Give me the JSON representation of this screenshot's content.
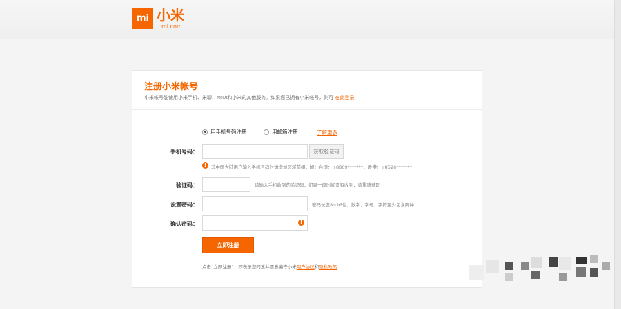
{
  "header": {
    "logo_mark": "mi",
    "logo_name": "小米",
    "logo_domain": "mi.com"
  },
  "card": {
    "title": "注册小米帐号",
    "subtitle_text": "小米帐号能使用小米手机、米聊、MIUI和小米的其他服务。如果您已拥有小米帐号，则可",
    "subtitle_link": "在此登录"
  },
  "register_options": {
    "phone_label": "用手机号码注册",
    "email_label": "用邮箱注册",
    "selected": "phone",
    "learn_more": "了解更多"
  },
  "form": {
    "phone_label": "手机号码：",
    "phone_value": "",
    "get_code_label": "获取验证码",
    "phone_hint": "非中国大陆用户输入手机号码时请增加区域前缀，如：台湾：+8869*******，香港：+8526*******",
    "code_label": "验证码：",
    "code_value": "",
    "code_hint": "请输入手机收到的验证码，如果一段时间没有收到，请重新获取",
    "password_label": "设置密码：",
    "password_value": "",
    "password_hint": "密码长度8~16位，数字、字母、字符至少包含两种",
    "confirm_label": "确认密码：",
    "confirm_value": "",
    "register_label": "立即注册"
  },
  "terms": {
    "prefix": "点击“立即注册”，即表示您同意并愿意遵守小米",
    "user_agreement": "用户协议",
    "and": "和",
    "privacy_policy": "隐私政策"
  },
  "colors": {
    "brand": "#f56600",
    "background": "#f4f4f4",
    "card": "#ffffff"
  }
}
